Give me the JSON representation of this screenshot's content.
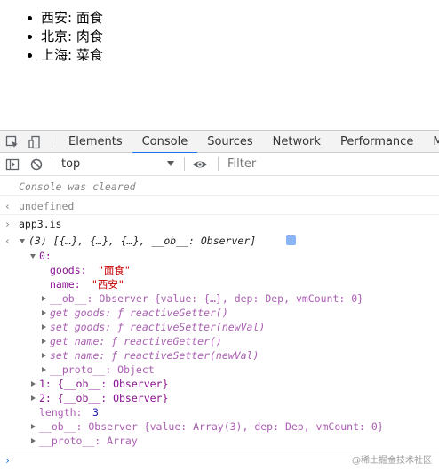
{
  "page": {
    "items": [
      "西安: 面食",
      "北京: 肉食",
      "上海: 菜食"
    ]
  },
  "devtools": {
    "tabs": [
      "Elements",
      "Console",
      "Sources",
      "Network",
      "Performance",
      "Me"
    ],
    "active_tab": "Console",
    "context": "top",
    "filter_placeholder": "Filter",
    "colors": {
      "accent": "#1a73e8",
      "string": "#c80000",
      "property": "#881391",
      "number": "#1a1aa6"
    }
  },
  "console": {
    "cleared": "Console was cleared",
    "undefined_result": "undefined",
    "input": "app3.is",
    "array_summary": "(3) [{…}, {…}, {…}, __ob__: Observer]",
    "info_badge": "i",
    "index0": "0:",
    "goods_key": "goods:",
    "goods_val": "\"面食\"",
    "name_key": "name:",
    "name_val": "\"西安\"",
    "ob_line": "__ob__: Observer {value: {…}, dep: Dep, vmCount: 0}",
    "get_goods": "get goods: ƒ reactiveGetter()",
    "set_goods": "set goods: ƒ reactiveSetter(newVal)",
    "get_name": "get name: ƒ reactiveGetter()",
    "set_name": "set name: ƒ reactiveSetter(newVal)",
    "proto_obj": "__proto__: Object",
    "item1": "1: {__ob__: Observer}",
    "item2": "2: {__ob__: Observer}",
    "length_key": "length:",
    "length_val": "3",
    "arr_ob": "__ob__: Observer {value: Array(3), dep: Dep, vmCount: 0}",
    "proto_arr": "__proto__: Array"
  },
  "watermark": "@稀土掘金技术社区"
}
